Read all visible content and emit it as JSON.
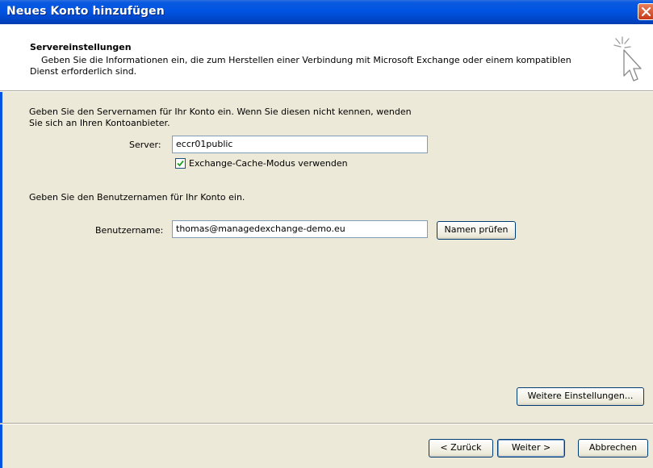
{
  "window": {
    "title": "Neues Konto hinzufügen"
  },
  "header": {
    "title": "Servereinstellungen",
    "description_line1": "Geben Sie die Informationen ein, die zum Herstellen einer Verbindung mit Microsoft Exchange oder einem kompatiblen",
    "description_line2": "Dienst erforderlich sind."
  },
  "server_section": {
    "instruction_line1": "Geben Sie den Servernamen für Ihr Konto ein. Wenn Sie diesen nicht kennen, wenden",
    "instruction_line2": "Sie sich an Ihren Kontoanbieter.",
    "server_label": "Server:",
    "server_value": "eccr01public",
    "cache_checkbox_label": "Exchange-Cache-Modus verwenden",
    "cache_checked": true
  },
  "user_section": {
    "instruction": "Geben Sie den Benutzernamen für Ihr Konto ein.",
    "username_label": "Benutzername:",
    "username_value": "thomas@managedexchange-demo.eu",
    "check_names_button": "Namen prüfen"
  },
  "buttons": {
    "more_settings": "Weitere Einstellungen...",
    "back": "< Zurück",
    "next": "Weiter >",
    "cancel": "Abbrechen"
  },
  "icons": {
    "close": "close-icon",
    "wizard": "wizard-cursor-icon",
    "checkmark": "checkmark-icon"
  },
  "colors": {
    "titlebar": "#0054e3",
    "dialog_bg": "#ece9d8",
    "close_button": "#d8542a"
  }
}
